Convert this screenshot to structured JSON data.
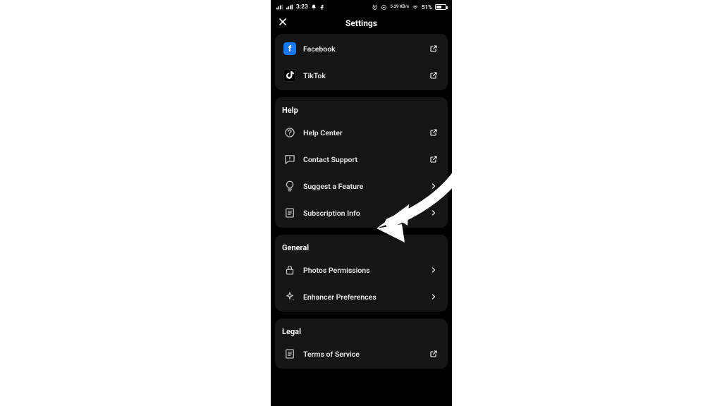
{
  "statusbar": {
    "time": "3:23",
    "battery_text": "51%",
    "net_label": "5.39 KB/s"
  },
  "header": {
    "title": "Settings"
  },
  "sections": {
    "social": {
      "items": [
        {
          "label": "Facebook"
        },
        {
          "label": "TikTok"
        }
      ]
    },
    "help": {
      "title": "Help",
      "items": [
        {
          "label": "Help Center"
        },
        {
          "label": "Contact Support"
        },
        {
          "label": "Suggest a Feature"
        },
        {
          "label": "Subscription Info"
        }
      ]
    },
    "general": {
      "title": "General",
      "items": [
        {
          "label": "Photos Permissions"
        },
        {
          "label": "Enhancer Preferences"
        }
      ]
    },
    "legal": {
      "title": "Legal",
      "items": [
        {
          "label": "Terms of Service"
        }
      ]
    }
  }
}
